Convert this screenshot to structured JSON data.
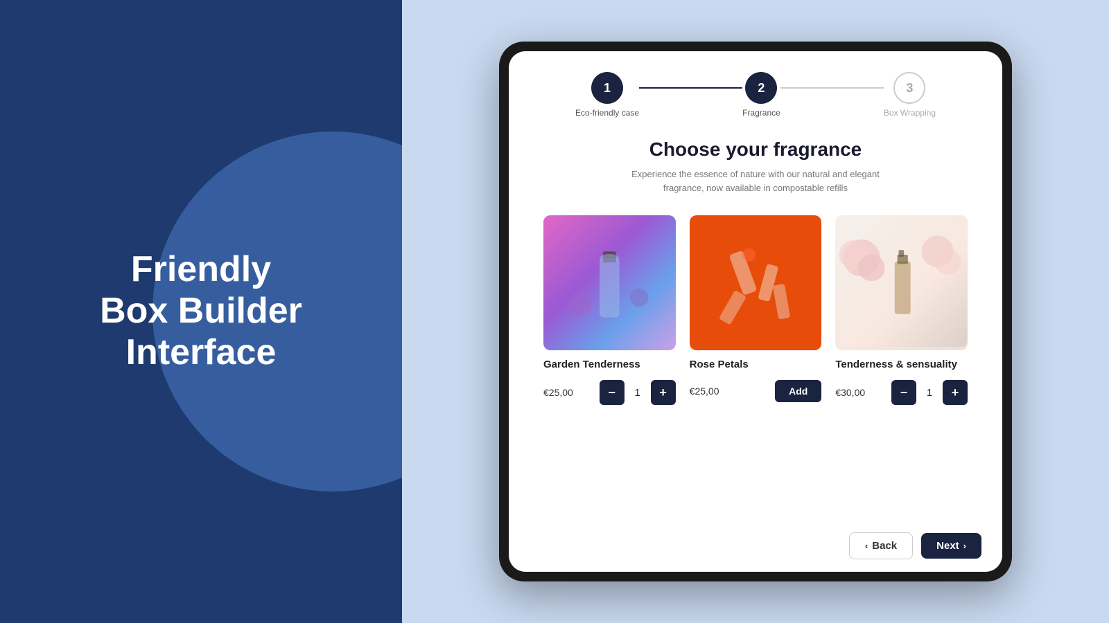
{
  "leftPanel": {
    "title": "Friendly\nBox Builder\nInterface"
  },
  "stepper": {
    "steps": [
      {
        "number": "1",
        "label": "Eco-friendly case",
        "state": "active"
      },
      {
        "number": "2",
        "label": "Fragrance",
        "state": "active"
      },
      {
        "number": "3",
        "label": "Box Wrapping",
        "state": "inactive"
      }
    ],
    "lines": [
      {
        "state": "active"
      },
      {
        "state": "inactive"
      }
    ]
  },
  "page": {
    "title": "Choose your fragrance",
    "subtitle": "Experience the essence of nature with our natural and elegant\nfragrance, now available in compostable refills"
  },
  "products": [
    {
      "id": "garden",
      "name": "Garden Tenderness",
      "price": "€25,00",
      "quantity": "1",
      "imageType": "garden",
      "hasQuantity": true
    },
    {
      "id": "rose",
      "name": "Rose Petals",
      "price": "€25,00",
      "quantity": null,
      "imageType": "rose",
      "hasQuantity": false,
      "addLabel": "Add"
    },
    {
      "id": "tenderness",
      "name": "Tenderness & sensuality",
      "price": "€30,00",
      "quantity": "1",
      "imageType": "tenderness",
      "hasQuantity": true
    }
  ],
  "footer": {
    "backLabel": "Back",
    "nextLabel": "Next"
  }
}
